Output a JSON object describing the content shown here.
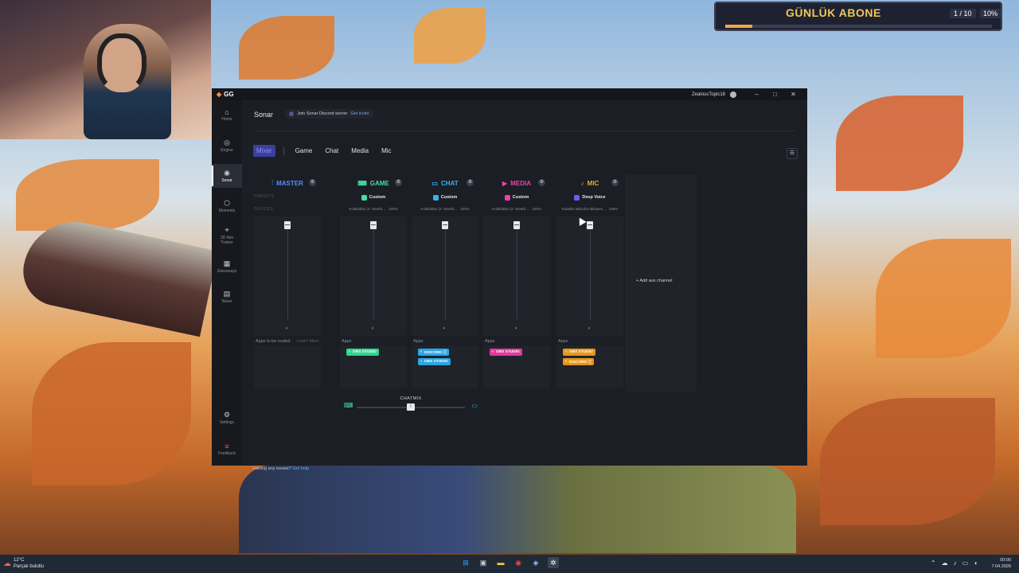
{
  "overlay": {
    "title": "GÜNLÜK ABONE",
    "count": "1 / 10",
    "percent": "10%",
    "progress": 0.1
  },
  "app": {
    "logo": "GG",
    "username": "ZealousTopic18"
  },
  "window_controls": {
    "minimize": "–",
    "maximize": "□",
    "close": "✕"
  },
  "sidebar": {
    "items": [
      {
        "label": "Home",
        "icon": "home-icon",
        "glyph": "⌂"
      },
      {
        "label": "Engine",
        "icon": "engine-icon",
        "glyph": "◎"
      },
      {
        "label": "Sonar",
        "icon": "sonar-icon",
        "glyph": "◉"
      },
      {
        "label": "Moments",
        "icon": "moments-icon",
        "glyph": "⬡"
      },
      {
        "label": "3D Aim",
        "label2": "Trainer",
        "icon": "aim-trainer-icon",
        "glyph": "⌖"
      },
      {
        "label": "Giveaways",
        "icon": "giveaways-icon",
        "glyph": "▦"
      },
      {
        "label": "News",
        "icon": "news-icon",
        "glyph": "▤"
      },
      {
        "label": "Settings",
        "icon": "gear-icon",
        "glyph": "⚙"
      },
      {
        "label": "Feedback",
        "icon": "feedback-icon",
        "glyph": "≡"
      }
    ]
  },
  "header": {
    "title": "Sonar",
    "discord_text": "Join Sonar Discord server",
    "discord_link": "Get invite"
  },
  "tabs": [
    "Mixer",
    "Game",
    "Chat",
    "Media",
    "Mic"
  ],
  "labels": {
    "presets": "PRESETS",
    "devices": "DEVICES",
    "apps": "Apps",
    "apps_routed": "Apps to be routed",
    "learn_more": "Learn More",
    "add_aux": "+ Add aux channel"
  },
  "channels": [
    {
      "name": "MASTER",
      "icon": "sliders-icon",
      "glyph": "⫶",
      "color": "#5b8cff"
    },
    {
      "name": "GAME",
      "icon": "gamepad-icon",
      "glyph": "🎮",
      "color": "#3fe0a4",
      "preset": "Custom",
      "device": "Kulaklıklar (2- SteelS...",
      "pct": "100%",
      "apps": [
        {
          "label": "OBS STUDIO",
          "color": "#2fd68e"
        }
      ]
    },
    {
      "name": "CHAT",
      "icon": "chat-icon",
      "glyph": "▭",
      "color": "#33b3f0",
      "preset": "Custom",
      "device": "Kulaklıklar (2- SteelS...",
      "pct": "100%",
      "apps": [
        {
          "label": "DISCORD ⓘ",
          "color": "#2aa6e6"
        },
        {
          "label": "OBS STUDIO",
          "color": "#2aa6e6"
        }
      ]
    },
    {
      "name": "MEDIA",
      "icon": "media-icon",
      "glyph": "▶",
      "color": "#ef3fa6",
      "preset": "Custom",
      "device": "Kulaklıklar (2- SteelS...",
      "pct": "100%",
      "apps": [
        {
          "label": "OBS STUDIO",
          "color": "#e23a9b"
        }
      ]
    },
    {
      "name": "MIC",
      "icon": "mic-icon",
      "glyph": "🎙",
      "color": "#f5a623",
      "preset": "Deep Voice",
      "device": "Kulaklık Mikrofon Bileşeni...",
      "pct": "100%",
      "apps": [
        {
          "label": "OBS STUDIO",
          "color": "#e6951e"
        },
        {
          "label": "DISCORD ⓘ",
          "color": "#e6951e"
        }
      ]
    }
  ],
  "chatmix": {
    "label": "CHATMIX",
    "thumb": "I",
    "position": 0.5
  },
  "footer": {
    "text": "Having any issues?",
    "link": "Get help"
  },
  "taskbar": {
    "temp": "12°C",
    "weather": "Parçalı bulutlu",
    "time": "00:00",
    "date": "7.04.2026"
  }
}
